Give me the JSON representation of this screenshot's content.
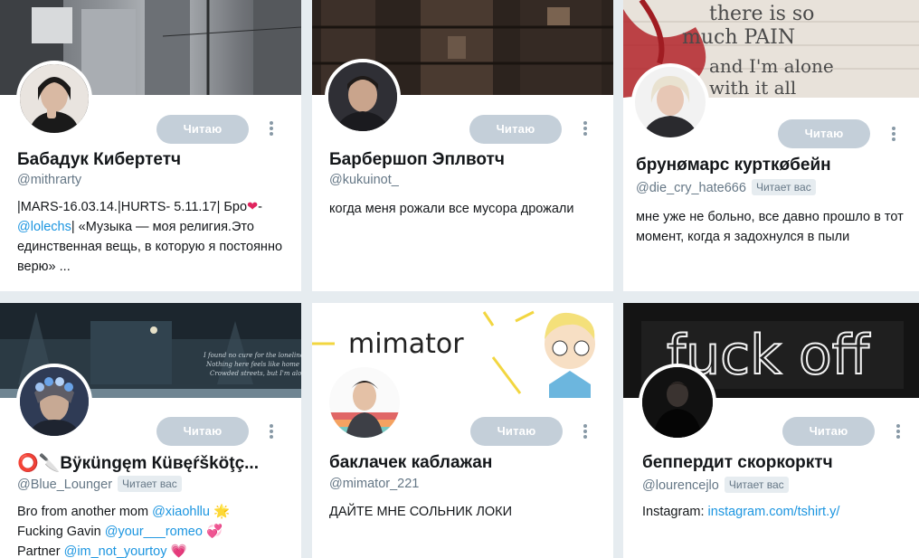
{
  "follow_label": "Читаю",
  "follows_you_label": "Читает вас",
  "colors": {
    "link": "#1b95e0",
    "button": "#c4cfd9",
    "background": "#e6ecf0"
  },
  "cards": [
    {
      "name": "Бабадук Кибертетч",
      "handle": "@mithrarty",
      "bio": [
        {
          "t": "|MARS-16.03.14.|HURTS- 5.11.17| Бро"
        },
        {
          "t": "❤",
          "c": "#e0245e"
        },
        {
          "t": "- "
        },
        {
          "t": "@lolechs",
          "link": true
        },
        {
          "t": "|     «Музыка — моя религия.Это единственная вещь, в которую я постоянно верю» ..."
        }
      ]
    },
    {
      "name": "Барбершоп Эплвотч",
      "handle": "@kukuinot_",
      "bio": [
        {
          "t": "когда меня рожали все мусора дрожали"
        }
      ]
    },
    {
      "name": "брунøмарс курткøбейн",
      "handle": "@die_cry_hate666",
      "follows_you": true,
      "bio": [
        {
          "t": "мне уже не больно, все давно прошло в тот момент, когда я задохнулся в пыли"
        }
      ],
      "banner_text": [
        "there is so",
        "much PAIN",
        "and I'm alone",
        "with it all"
      ]
    },
    {
      "name": "⭕🔪Вÿкüngęm Кüвęŕšköţç...",
      "handle": "@Blue_Lounger",
      "follows_you": true,
      "bio_lines": [
        [
          {
            "t": "Bro from another mom "
          },
          {
            "t": "@xiaohllu",
            "link": true
          },
          {
            "t": " 🌟"
          }
        ],
        [
          {
            "t": "Fucking Gavin "
          },
          {
            "t": "@your___romeo",
            "link": true
          },
          {
            "t": " 💞"
          }
        ],
        [
          {
            "t": "Partner "
          },
          {
            "t": "@im_not_yourtoy",
            "link": true
          },
          {
            "t": " 💗"
          }
        ]
      ]
    },
    {
      "name": "баклачек каблажан",
      "handle": "@mimator_221",
      "bio": [
        {
          "t": "ДАЙТЕ МНЕ СОЛЬНИК ЛОКИ"
        }
      ],
      "banner_text": [
        "mimator"
      ]
    },
    {
      "name": "беппердит скоркорктч",
      "handle": "@lourencejlo",
      "follows_you": true,
      "bio": [
        {
          "t": "Instagram: "
        },
        {
          "t": "instagram.com/tshirt.y/",
          "link": true
        }
      ],
      "banner_text": [
        "fuck off"
      ]
    }
  ]
}
